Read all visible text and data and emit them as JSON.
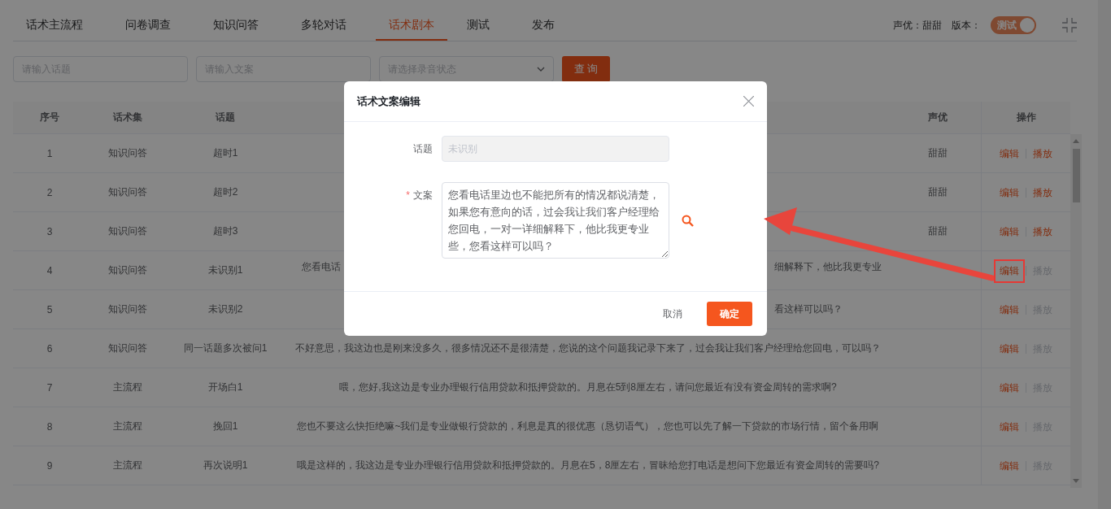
{
  "tabs": [
    {
      "label": "话术主流程",
      "selected": false
    },
    {
      "label": "问卷调查",
      "selected": false
    },
    {
      "label": "知识问答",
      "selected": false
    },
    {
      "label": "多轮对话",
      "selected": false
    },
    {
      "label": "话术剧本",
      "selected": true
    },
    {
      "label": "测试",
      "selected": false
    },
    {
      "label": "发布",
      "selected": false
    }
  ],
  "header_info": {
    "voice": "声优：甜甜",
    "version_label": "版本：",
    "version_switch": {
      "label": "测试",
      "on": true
    }
  },
  "filters": {
    "topic": {
      "placeholder": "请输入话题"
    },
    "text": {
      "placeholder": "请输入文案"
    },
    "status": {
      "placeholder": "请选择录音状态"
    },
    "query_button": "查 询"
  },
  "table": {
    "columns": [
      "序号",
      "话术集",
      "话题",
      "声优",
      "操作"
    ],
    "rows": [
      {
        "index": "1",
        "set": "知识问答",
        "topic": "超时1",
        "voice": "甜甜",
        "edit": "编辑",
        "play": "播放",
        "play_enabled": true,
        "highlighted": false
      },
      {
        "index": "2",
        "set": "知识问答",
        "topic": "超时2",
        "voice": "甜甜",
        "edit": "编辑",
        "play": "播放",
        "play_enabled": true,
        "highlighted": false
      },
      {
        "index": "3",
        "set": "知识问答",
        "topic": "超时3",
        "voice": "甜甜",
        "edit": "编辑",
        "play": "播放",
        "play_enabled": true,
        "highlighted": false
      },
      {
        "index": "4",
        "set": "知识问答",
        "topic": "未识别1",
        "text_start": "您看电话",
        "text_end": "细解释下，他比我更专业",
        "edit": "编辑",
        "play": "播放",
        "play_enabled": false,
        "highlighted": true
      },
      {
        "index": "5",
        "set": "知识问答",
        "topic": "未识别2",
        "text_end": "看这样可以吗？",
        "edit": "编辑",
        "play": "播放",
        "play_enabled": false,
        "highlighted": false
      },
      {
        "index": "6",
        "set": "知识问答",
        "topic": "同一话题多次被问1",
        "text": "不好意思，我这边也是刚来没多久，很多情况还不是很清楚，您说的这个问题我记录下来了，过会我让我们客户经理给您回电，可以吗？",
        "edit": "编辑",
        "play": "播放",
        "play_enabled": false,
        "highlighted": false
      },
      {
        "index": "7",
        "set": "主流程",
        "topic": "开场白1",
        "text": "喂，您好,我这边是专业办理银行信用贷款和抵押贷款的。月息在5到8厘左右，请问您最近有没有资金周转的需求啊?",
        "edit": "编辑",
        "play": "播放",
        "play_enabled": false,
        "highlighted": false
      },
      {
        "index": "8",
        "set": "主流程",
        "topic": "挽回1",
        "text": "您也不要这么快拒绝嘛~我们是专业做银行贷款的，利息是真的很优惠（恳切语气），您也可以先了解一下贷款的市场行情，留个备用啊",
        "edit": "编辑",
        "play": "播放",
        "play_enabled": false,
        "highlighted": false
      },
      {
        "index": "9",
        "set": "主流程",
        "topic": "再次说明1",
        "text": "哦是这样的，我这边是专业办理银行信用贷款和抵押贷款的。月息在5，8厘左右，冒昧给您打电话是想问下您最近有资金周转的需要吗?",
        "edit": "编辑",
        "play": "播放",
        "play_enabled": false,
        "highlighted": false
      }
    ]
  },
  "dialog": {
    "title": "话术文案编辑",
    "topic_label": "话题",
    "topic_placeholder": "未识别",
    "text_label": "文案",
    "required_mark": "*",
    "text_value": "您看电话里边也不能把所有的情况都说清楚，如果您有意向的话，过会我让我们客户经理给您回电，一对一详细解释下，他比我更专业些，您看这样可以吗？",
    "cancel": "取消",
    "confirm": "确定"
  }
}
